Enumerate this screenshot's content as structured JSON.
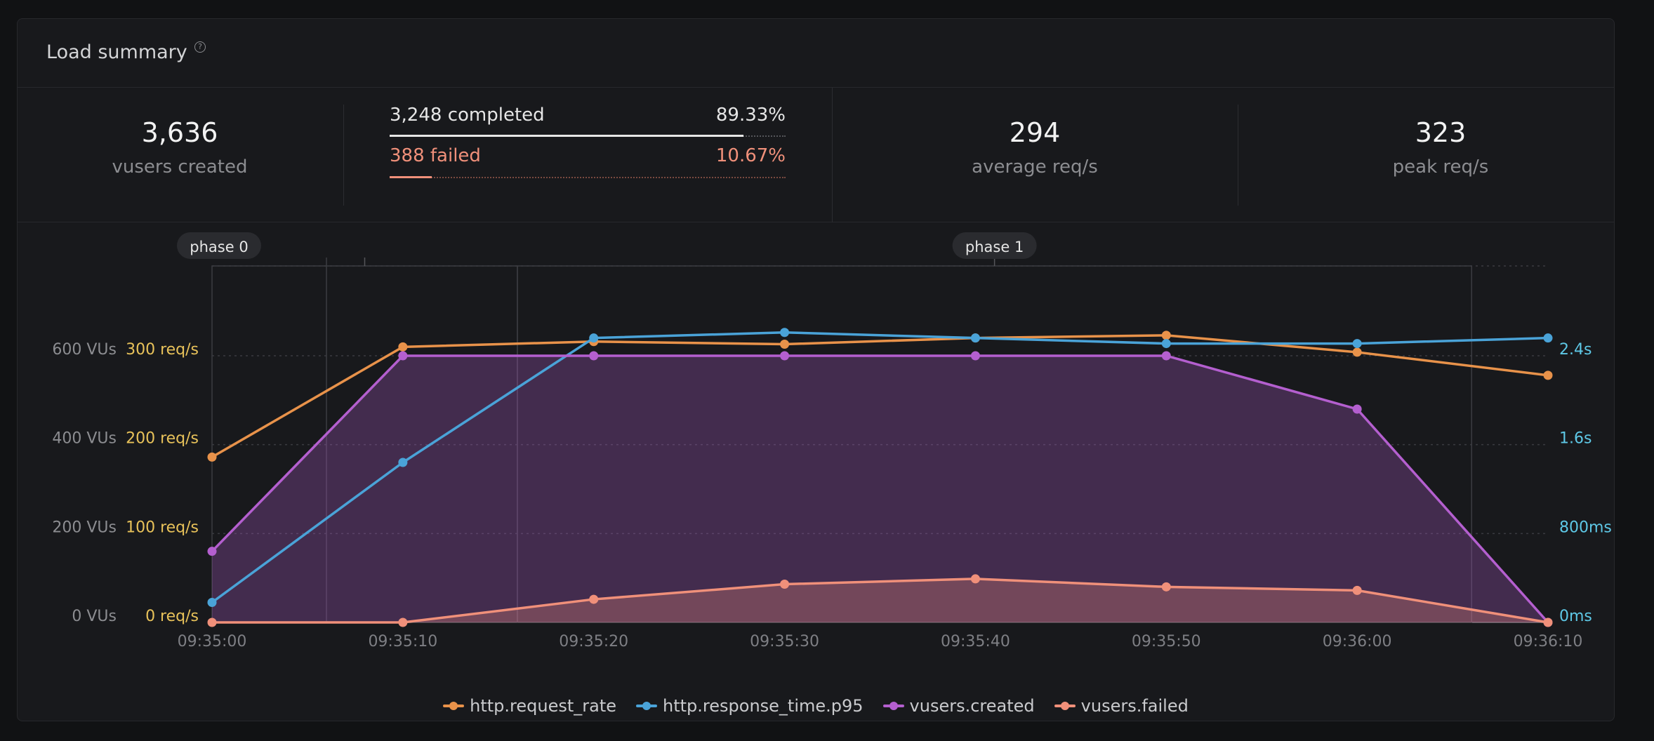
{
  "panel": {
    "title": "Load summary",
    "help_icon": "help-circle-icon"
  },
  "stats": {
    "vusers_created": {
      "value": "3,636",
      "label": "vusers created"
    },
    "completed": {
      "label": "3,248 completed",
      "percent": "89.33%",
      "fraction": 0.8933
    },
    "failed": {
      "label": "388 failed",
      "percent": "10.67%",
      "fraction": 0.1067
    },
    "average_rps": {
      "value": "294",
      "label": "average req/s"
    },
    "peak_rps": {
      "value": "323",
      "label": "peak req/s"
    }
  },
  "colors": {
    "request_rate": "#e8924a",
    "response_time": "#4aa3d8",
    "vusers_created": "#b45fcf",
    "vusers_failed": "#f0907a",
    "completed_bar": "#e6e6e6",
    "failed_text": "#f0907a",
    "left_axis_vus": "#8c8d91",
    "left_axis_req": "#e8c25a",
    "right_axis": "#5ec8e6"
  },
  "chart_data": {
    "type": "line",
    "x": [
      "09:35:00",
      "09:35:10",
      "09:35:20",
      "09:35:30",
      "09:35:40",
      "09:35:50",
      "09:36:00",
      "09:36:10"
    ],
    "axes": {
      "vus": {
        "ticks": [
          "0 VUs",
          "200 VUs",
          "400 VUs",
          "600 VUs"
        ],
        "range": [
          0,
          600
        ]
      },
      "req": {
        "ticks": [
          "0 req/s",
          "100 req/s",
          "200 req/s",
          "300 req/s"
        ],
        "range": [
          0,
          300
        ]
      },
      "time": {
        "ticks": [
          "0ms",
          "800ms",
          "1.6s",
          "2.4s"
        ],
        "range": [
          0,
          2400
        ]
      }
    },
    "phases": [
      {
        "label": "phase 0",
        "start": 0,
        "end": 1.6
      },
      {
        "label": "phase 1",
        "start": 1.6,
        "end": 6.6
      }
    ],
    "series": [
      {
        "name": "http.request_rate",
        "axis": "req",
        "color": "#e8924a",
        "area": false,
        "values": [
          186,
          310,
          316,
          313,
          320,
          323,
          304,
          278
        ]
      },
      {
        "name": "http.response_time.p95",
        "axis": "time",
        "color": "#4aa3d8",
        "area": false,
        "values": [
          180,
          1440,
          2560,
          2610,
          2560,
          2510,
          2510,
          2560
        ]
      },
      {
        "name": "vusers.created",
        "axis": "vus",
        "color": "#b45fcf",
        "area": true,
        "values": [
          160,
          600,
          600,
          600,
          600,
          600,
          480,
          0
        ]
      },
      {
        "name": "vusers.failed",
        "axis": "vus",
        "color": "#f0907a",
        "area": true,
        "values": [
          0,
          0,
          52,
          86,
          98,
          80,
          72,
          0
        ]
      }
    ],
    "grid": true,
    "legend": "bottom"
  }
}
